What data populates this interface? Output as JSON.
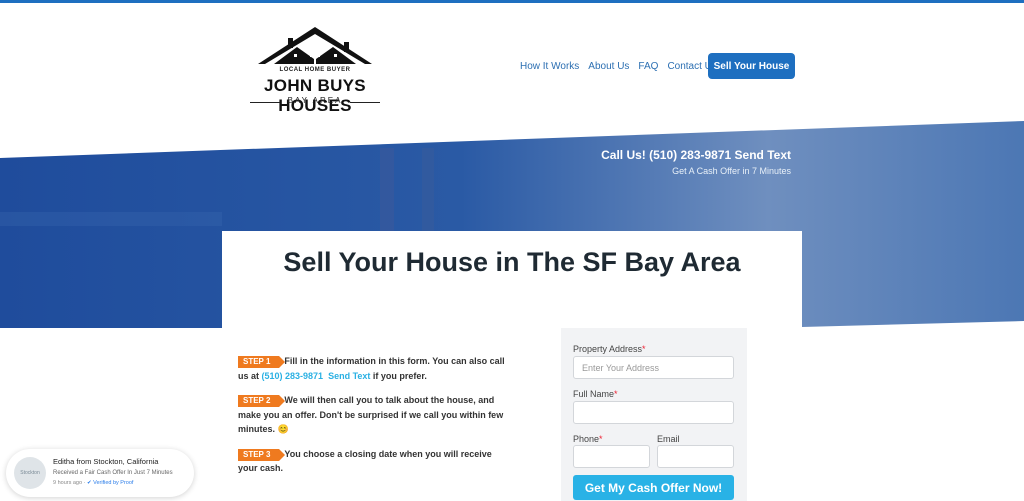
{
  "brand": {
    "tagline": "LOCAL HOME BUYER",
    "name": "JOHN BUYS HOUSES",
    "subtitle": "BAY AREA"
  },
  "nav": {
    "items": [
      "How It Works",
      "About Us",
      "FAQ",
      "Contact Us"
    ],
    "cta": "Sell Your House"
  },
  "hero": {
    "call": "Call Us! (510) 283-9871  Send Text",
    "offer": "Get A Cash Offer in 7 Minutes"
  },
  "main": {
    "headline": "Sell Your House in The SF Bay Area"
  },
  "steps": [
    {
      "badge": "STEP 1",
      "text_before": "Fill in the information in this form. You can also call us at ",
      "phone": "(510) 283-9871",
      "send_text": "Send Text",
      "text_after": " if you prefer."
    },
    {
      "badge": "STEP 2",
      "text": "We will then call you to talk about the house, and make you an offer. Don't be surprised if we call you within few minutes. 😊"
    },
    {
      "badge": "STEP 3",
      "text": "You choose a closing date when you will receive your cash."
    }
  ],
  "form": {
    "address_label": "Property Address",
    "address_placeholder": "Enter Your Address",
    "name_label": "Full Name",
    "phone_label": "Phone",
    "email_label": "Email",
    "submit": "Get My Cash Offer Now!"
  },
  "proof": {
    "name": "Editha from Stockton, California",
    "message": "Received a Fair Cash Offer In Just 7 Minutes",
    "time": "9 hours ago",
    "verified": "Verified by Proof",
    "avatar_text": "Stockton"
  },
  "colors": {
    "accent": "#1e6fc0",
    "cta": "#29b2e6",
    "step_badge": "#ef7a1f"
  }
}
